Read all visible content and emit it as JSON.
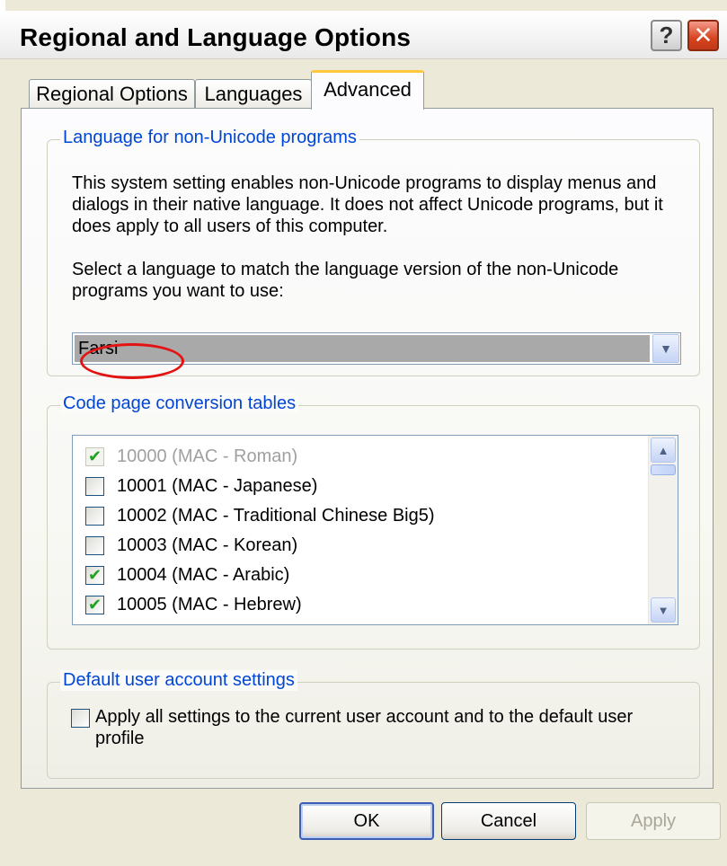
{
  "window": {
    "title": "Regional and Language Options"
  },
  "titlebar": {
    "help_label": "?",
    "close_label": "✕"
  },
  "tabs": [
    {
      "label": "Regional Options",
      "active": false
    },
    {
      "label": "Languages",
      "active": false
    },
    {
      "label": "Advanced",
      "active": true
    }
  ],
  "non_unicode": {
    "legend": "Language for non-Unicode programs",
    "description": "This system setting enables non-Unicode programs to display menus and dialogs in their native language. It does not affect Unicode programs, but it does apply to all users of this computer.",
    "instruction": "Select a language to match the language version of the non-Unicode programs you want to use:",
    "selected_language": "Farsi",
    "dropdown_icon": "chevron-down-icon"
  },
  "code_pages": {
    "legend": "Code page conversion tables",
    "items": [
      {
        "label": "10000 (MAC - Roman)",
        "checked": true,
        "disabled": true
      },
      {
        "label": "10001 (MAC - Japanese)",
        "checked": false,
        "disabled": false
      },
      {
        "label": "10002 (MAC - Traditional Chinese Big5)",
        "checked": false,
        "disabled": false
      },
      {
        "label": "10003 (MAC - Korean)",
        "checked": false,
        "disabled": false
      },
      {
        "label": "10004 (MAC - Arabic)",
        "checked": true,
        "disabled": false
      },
      {
        "label": "10005 (MAC - Hebrew)",
        "checked": true,
        "disabled": false
      }
    ]
  },
  "default_user": {
    "legend": "Default user account settings",
    "checkbox_label": "Apply all settings to the current user account and to the default user profile",
    "checked": false
  },
  "buttons": {
    "ok": "OK",
    "cancel": "Cancel",
    "apply": "Apply",
    "apply_enabled": false
  },
  "colors": {
    "legend_blue": "#0046d5",
    "active_tab_accent": "#ffc83c",
    "close_button": "#d8431f",
    "annotation_red": "#e31313",
    "check_green": "#21a121"
  }
}
